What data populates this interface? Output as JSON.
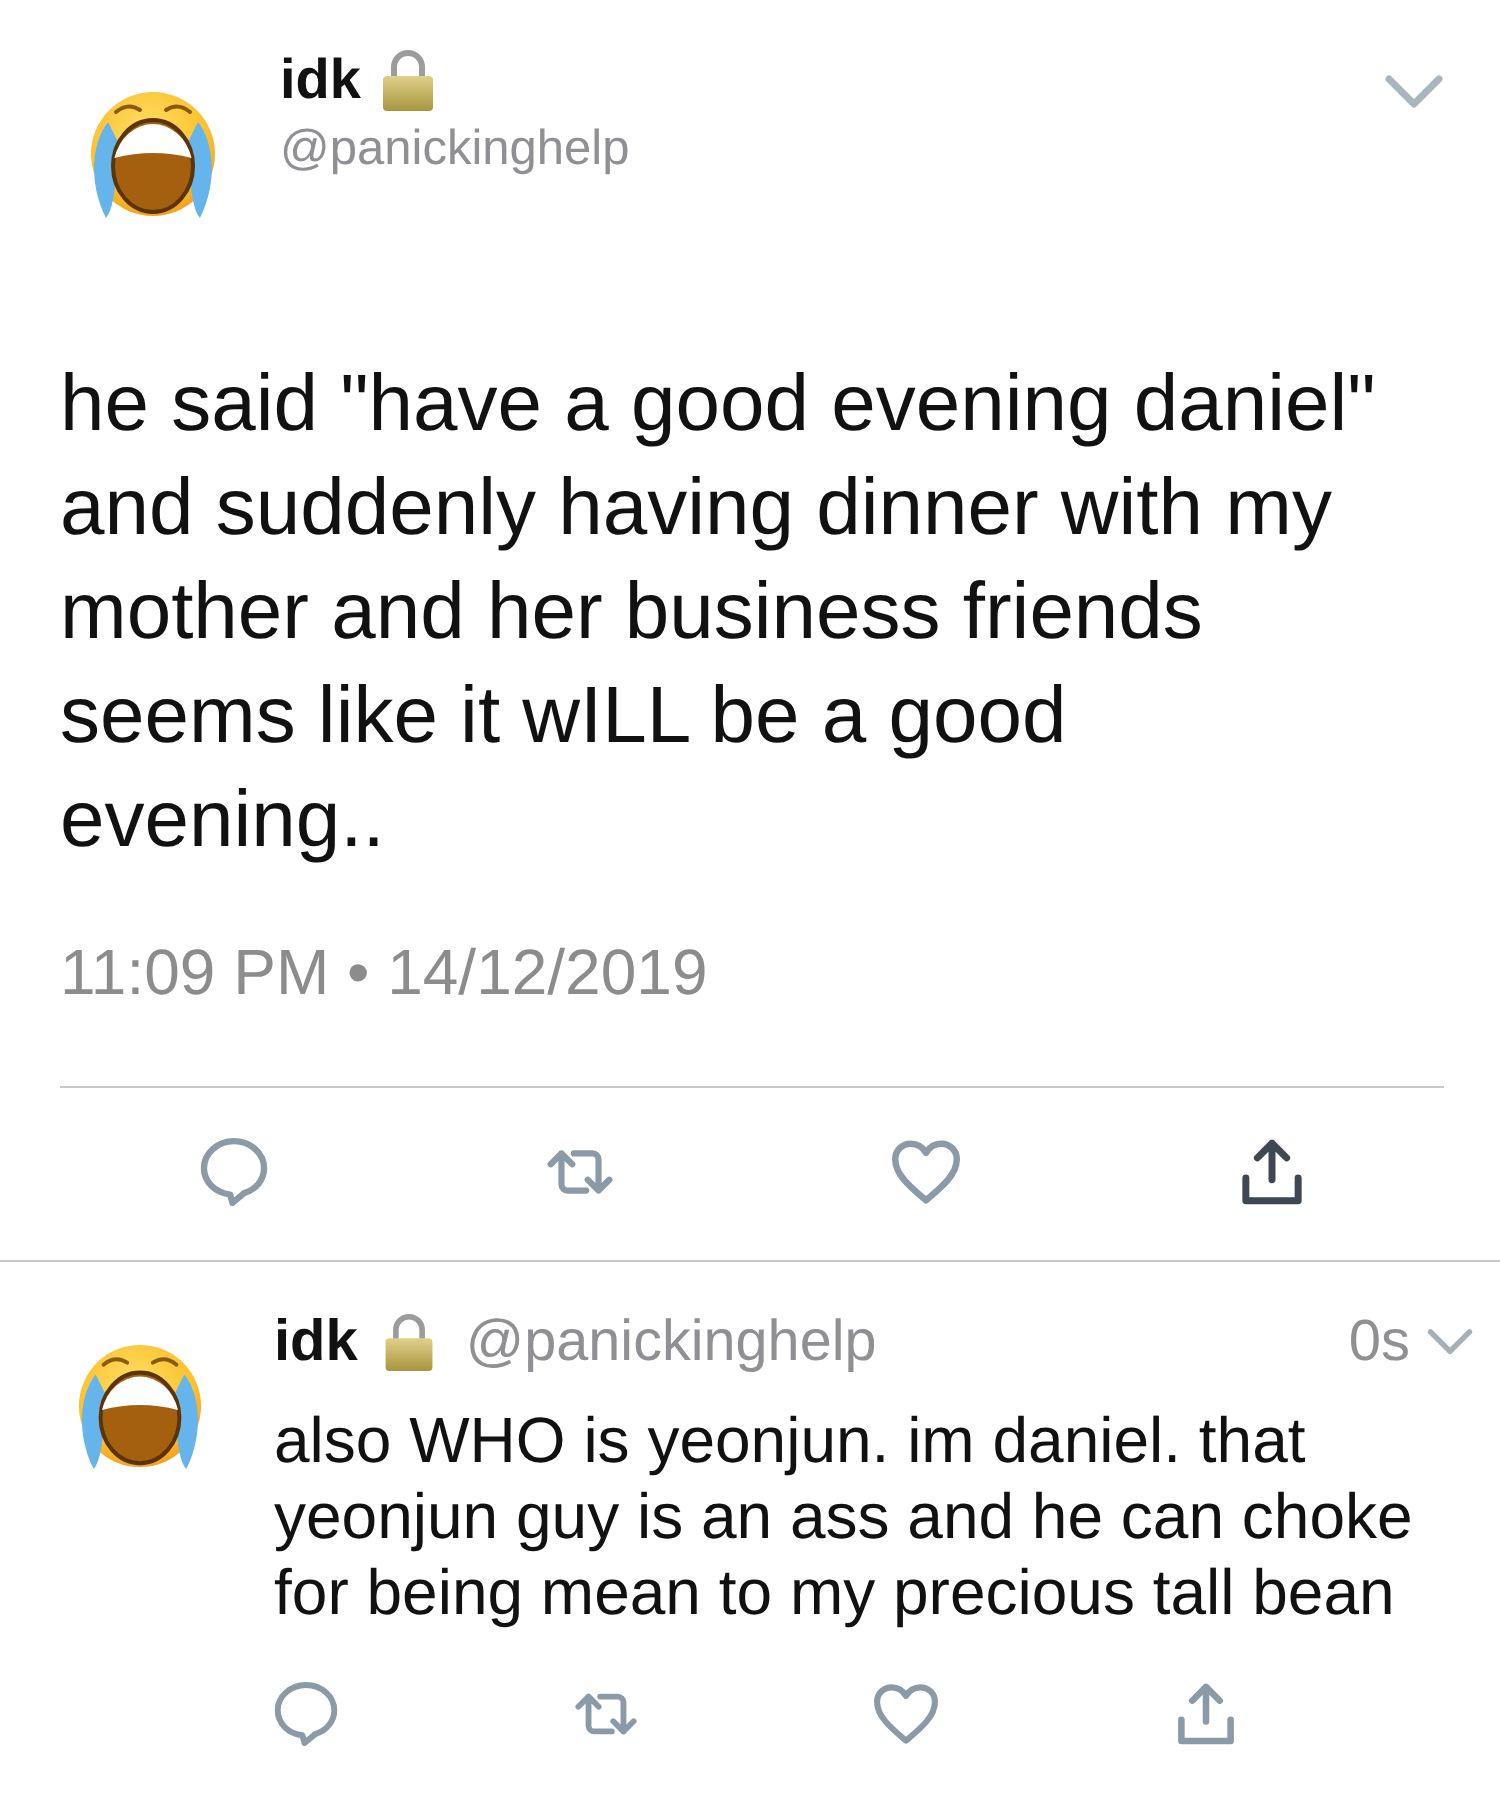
{
  "tweet": {
    "author": {
      "name": "idk",
      "protected": true,
      "handle": "@panickinghelp"
    },
    "text": "he said \"have a good evening daniel\" and suddenly having dinner with my mother and her business friends seems like it wILL be a good evening..",
    "timestamp": "11:09 PM • 14/12/2019",
    "actions": [
      {
        "kind": "reply"
      },
      {
        "kind": "retweet"
      },
      {
        "kind": "like"
      },
      {
        "kind": "share"
      }
    ]
  },
  "replies": [
    {
      "author": {
        "name": "idk",
        "protected": true,
        "handle": "@panickinghelp"
      },
      "time": "0s",
      "text": "also WHO is yeonjun. im daniel. that yeonjun guy is an ass and he can choke for being mean to my precious tall bean",
      "actions": [
        {
          "kind": "reply"
        },
        {
          "kind": "retweet"
        },
        {
          "kind": "like"
        },
        {
          "kind": "share"
        }
      ]
    }
  ]
}
